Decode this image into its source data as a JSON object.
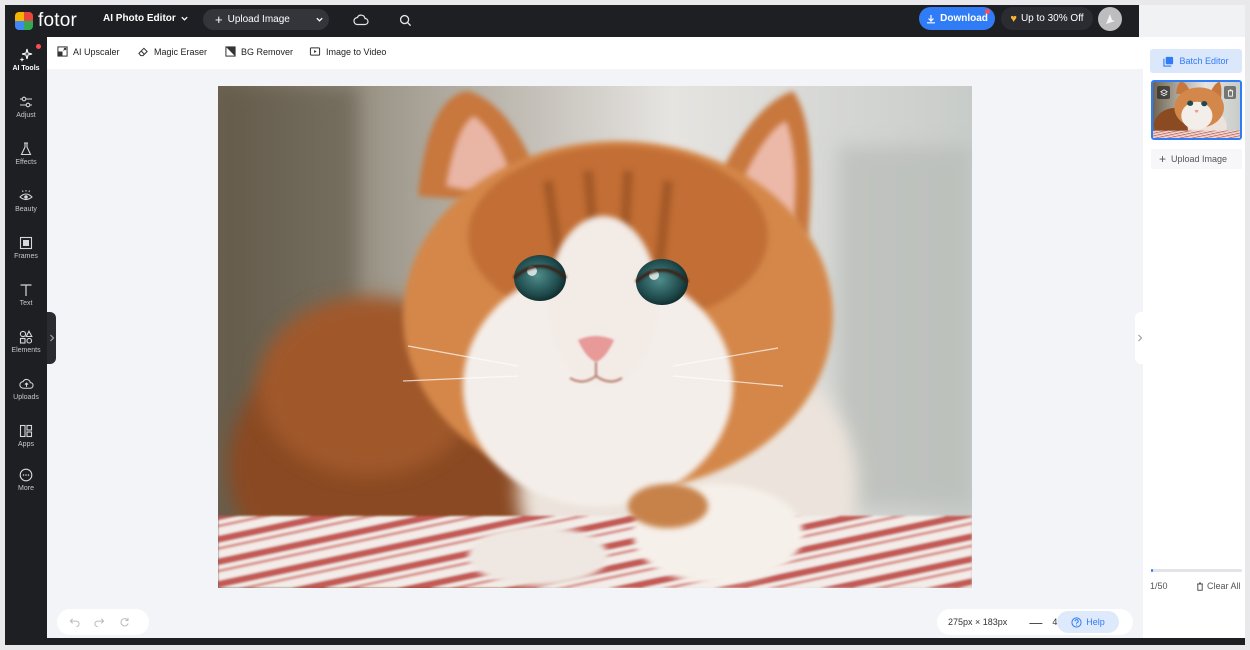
{
  "brand": {
    "name": "fotor"
  },
  "header": {
    "product_menu": "AI Photo Editor",
    "upload_label": "Upload Image",
    "download_label": "Download",
    "promo_label": "Up to 30% Off",
    "icons": [
      "cloud-icon",
      "search-icon"
    ]
  },
  "sidebar": {
    "items": [
      {
        "label": "AI Tools",
        "icon": "sparkle-icon"
      },
      {
        "label": "Adjust",
        "icon": "sliders-icon"
      },
      {
        "label": "Effects",
        "icon": "flask-icon"
      },
      {
        "label": "Beauty",
        "icon": "eye-icon"
      },
      {
        "label": "Frames",
        "icon": "frame-icon"
      },
      {
        "label": "Text",
        "icon": "text-icon"
      },
      {
        "label": "Elements",
        "icon": "shapes-icon"
      },
      {
        "label": "Uploads",
        "icon": "cloud-upload-icon"
      },
      {
        "label": "Apps",
        "icon": "apps-icon"
      },
      {
        "label": "More",
        "icon": "more-icon"
      }
    ]
  },
  "toolbar": {
    "items": [
      {
        "label": "AI Upscaler",
        "icon": "upscale-icon"
      },
      {
        "label": "Magic Eraser",
        "icon": "eraser-icon"
      },
      {
        "label": "BG Remover",
        "icon": "bg-remover-icon"
      },
      {
        "label": "Image to Video",
        "icon": "video-icon"
      }
    ]
  },
  "canvas": {
    "image_subject": "kitten photo",
    "size_readout": "275px × 183px",
    "zoom_value": "42"
  },
  "help": {
    "label": "Help"
  },
  "right_panel": {
    "batch_label": "Batch Editor",
    "add_image_label": "Upload Image",
    "count": "1/50",
    "clear_label": "Clear All",
    "progress_fraction": 0.02
  },
  "colors": {
    "accent": "#2f7cf6",
    "dark": "#1e1f23",
    "notification": "#ff4d4f",
    "promo": "#f7b733"
  }
}
